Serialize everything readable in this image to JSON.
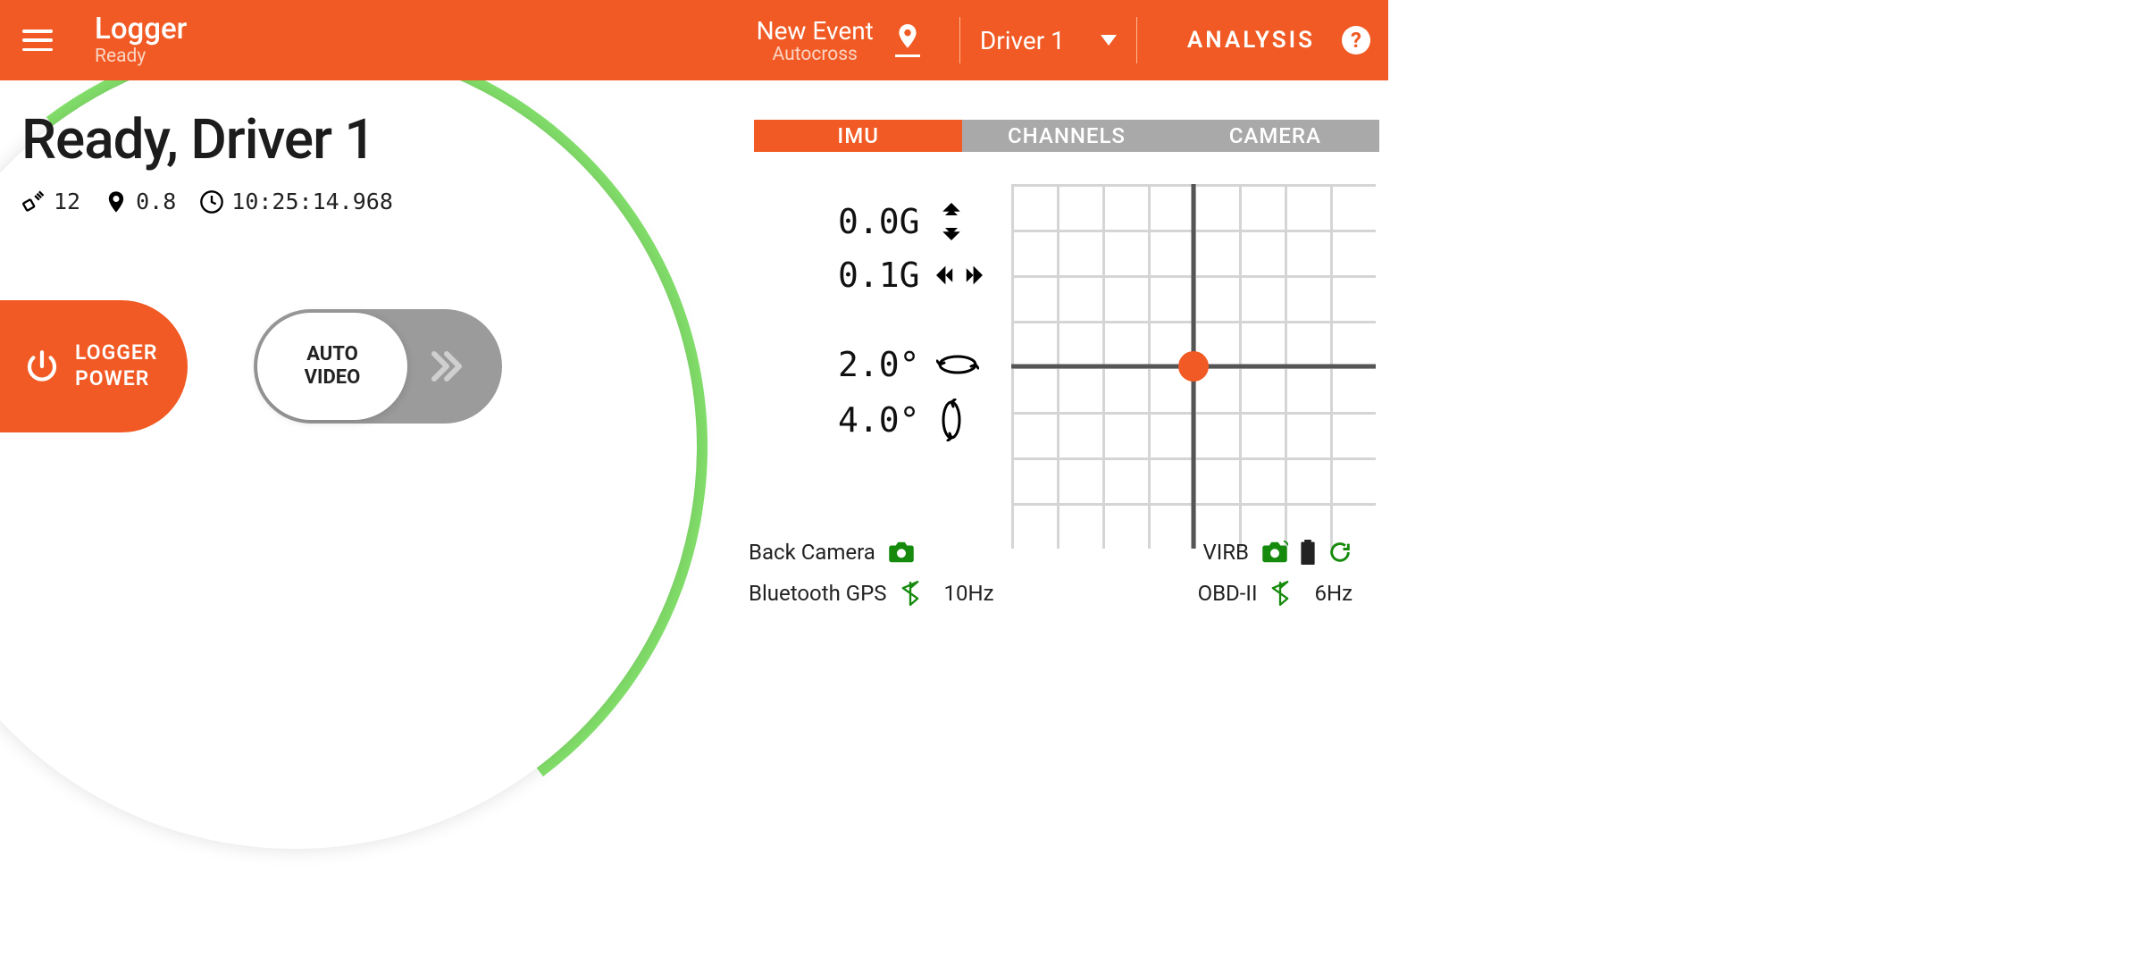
{
  "header": {
    "app_title": "Logger",
    "app_status": "Ready",
    "event_title": "New Event",
    "event_type": "Autocross",
    "driver_label": "Driver 1",
    "analysis_label": "ANALYSIS"
  },
  "main": {
    "ready_title": "Ready, Driver 1",
    "sat_count": "12",
    "gps_accuracy": "0.8",
    "clock": "10:25:14.968",
    "logger_power_label_1": "LOGGER",
    "logger_power_label_2": "POWER",
    "auto_video_label_1": "AUTO",
    "auto_video_label_2": "VIDEO"
  },
  "tabs": {
    "items": [
      {
        "label": "IMU",
        "active": true
      },
      {
        "label": "CHANNELS",
        "active": false
      },
      {
        "label": "CAMERA",
        "active": false
      }
    ]
  },
  "imu": {
    "long_g": "0.0G",
    "lat_g": "0.1G",
    "pitch": "2.0°",
    "roll": "4.0°"
  },
  "status": {
    "back_camera_label": "Back Camera",
    "virb_label": "VIRB",
    "bt_gps_label": "Bluetooth GPS",
    "bt_gps_rate": "10Hz",
    "obd_label": "OBD-II",
    "obd_rate": "6Hz"
  },
  "colors": {
    "accent": "#f15a24",
    "ok_green": "#168a0d"
  }
}
